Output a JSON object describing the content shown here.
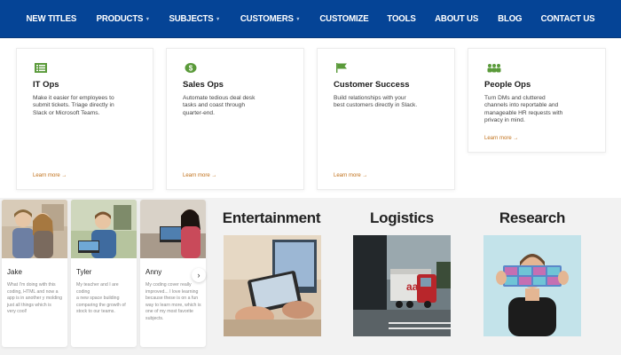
{
  "nav": {
    "items": [
      {
        "label": "NEW TITLES",
        "dropdown": false
      },
      {
        "label": "PRODUCTS",
        "dropdown": true
      },
      {
        "label": "SUBJECTS",
        "dropdown": true
      },
      {
        "label": "CUSTOMERS",
        "dropdown": true
      },
      {
        "label": "CUSTOMIZE",
        "dropdown": false
      },
      {
        "label": "TOOLS",
        "dropdown": false
      },
      {
        "label": "ABOUT US",
        "dropdown": false
      },
      {
        "label": "BLOG",
        "dropdown": false
      },
      {
        "label": "CONTACT US",
        "dropdown": false
      }
    ],
    "chevron": "▾"
  },
  "features": [
    {
      "icon": "list-icon",
      "title": "IT Ops",
      "desc": [
        "Make it easier for employees to",
        "submit tickets. Triage directly in",
        "Slack or Microsoft Teams."
      ],
      "link": "Learn more →"
    },
    {
      "icon": "dollar-icon",
      "title": "Sales Ops",
      "desc": [
        "Automate tedious deal desk",
        "tasks and coast through",
        "quarter-end."
      ],
      "link": "Learn more →"
    },
    {
      "icon": "flag-icon",
      "title": "Customer Success",
      "desc": [
        "Build relationships with your",
        "best customers directly in Slack."
      ],
      "link": "Learn more →"
    },
    {
      "icon": "people-icon",
      "title": "People Ops",
      "desc": [
        "Turn DMs and cluttered",
        "channels into reportable and",
        "manageable HR requests with",
        "privacy in mind."
      ],
      "link": "Learn more →"
    }
  ],
  "people": [
    {
      "name": "Jake",
      "desc": [
        "What I'm doing with this",
        "coding, HTML and now a",
        "app is in another y molding",
        "just all things which is",
        "very cool!"
      ]
    },
    {
      "name": "Tyler",
      "desc": [
        "My teacher and I are coding",
        "a new space building",
        "comparing the growth of",
        "stock to our teams."
      ]
    },
    {
      "name": "Anny",
      "desc": [
        "My coding cover really",
        "improved... I love learning",
        "because these is on a fun",
        "way to learn more, which is",
        "one of my most favorite",
        "subjects."
      ]
    }
  ],
  "next_arrow": "›",
  "categories": [
    {
      "title": "Entertainment"
    },
    {
      "title": "Logistics"
    },
    {
      "title": "Research"
    }
  ],
  "colors": {
    "nav_bg": "#054496",
    "accent_green": "#5a9a3a",
    "link_orange": "#c0701a"
  }
}
